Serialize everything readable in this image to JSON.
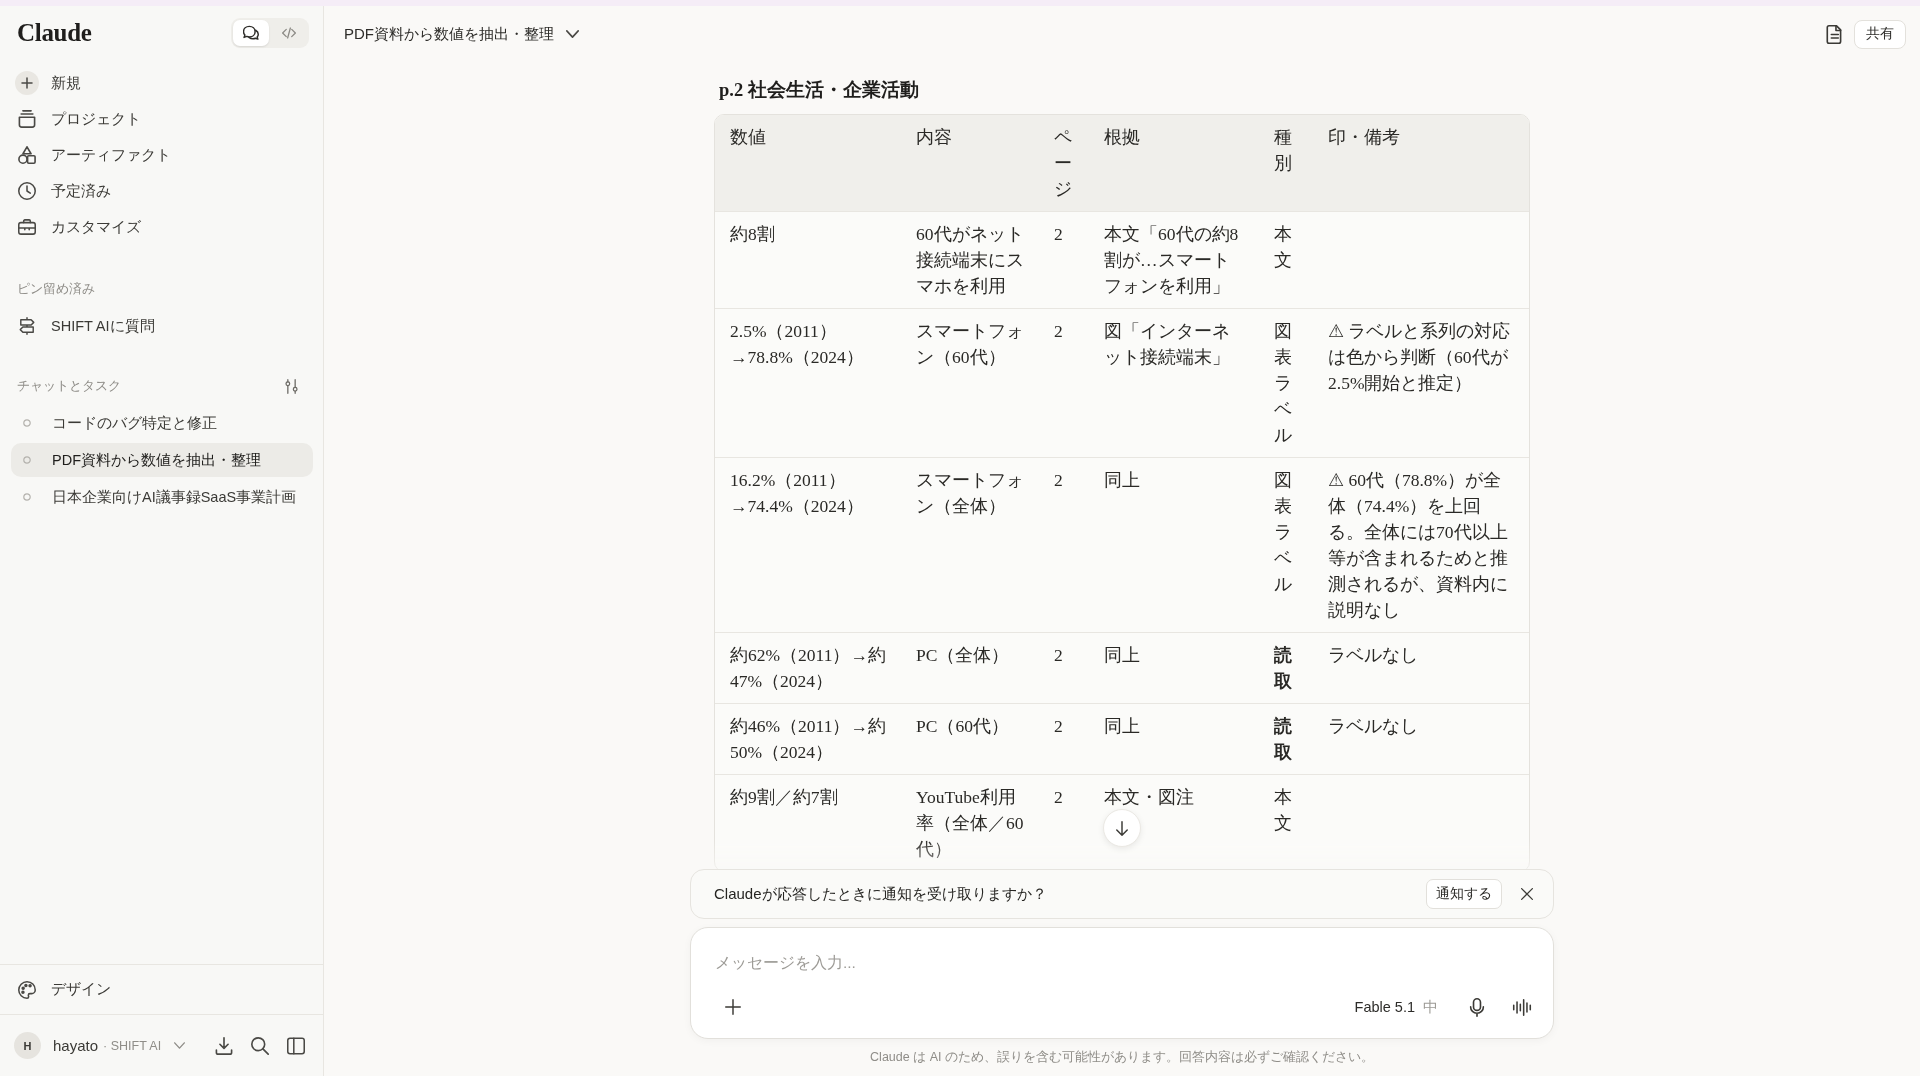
{
  "sidebar": {
    "logo": "Claude",
    "mode_tabs": [
      {
        "selected": true
      },
      {
        "selected": false
      }
    ],
    "nav": [
      {
        "label": "新規"
      },
      {
        "label": "プロジェクト"
      },
      {
        "label": "アーティファクト"
      },
      {
        "label": "予定済み"
      },
      {
        "label": "カスタマイズ"
      }
    ],
    "pinned": {
      "title": "ピン留め済み",
      "items": [
        {
          "label": "SHIFT AIに質問"
        }
      ]
    },
    "chats": {
      "title": "チャットとタスク",
      "items": [
        {
          "label": "コードのバグ特定と修正",
          "selected": false
        },
        {
          "label": "PDF資料から数値を抽出・整理",
          "selected": true
        },
        {
          "label": "日本企業向けAI議事録SaaS事業計画",
          "selected": false
        }
      ]
    },
    "design": {
      "label": "デザイン"
    },
    "user": {
      "initial": "H",
      "name": "hayato",
      "org": "· SHIFT AI"
    }
  },
  "header": {
    "title": "PDF資料から数値を抽出・整理",
    "share": "共有"
  },
  "content": {
    "heading": "p.2 社会生活・企業活動",
    "table": {
      "columns": [
        "数値",
        "内容",
        "ページ",
        "根拠",
        "種別",
        "印・備考"
      ],
      "rows": [
        {
          "cells": [
            "約8割",
            "60代がネット接続端末にスマホを利用",
            "2",
            "本文「60代の約8割が…スマートフォンを利用」",
            "本文"
          ],
          "category_bold": false
        },
        {
          "cells": [
            "2.5%（2011）→78.8%（2024）",
            "スマートフォン（60代）",
            "2",
            "図「インターネット接続端末」",
            "図表ラベル",
            "⚠ ラベルと系列の対応は色から判断（60代が2.5%開始と推定）"
          ],
          "category_bold": false
        },
        {
          "cells": [
            "16.2%（2011）→74.4%（2024）",
            "スマートフォン（全体）",
            "2",
            "同上",
            "図表ラベル",
            "⚠ 60代（78.8%）が全体（74.4%）を上回る。全体には70代以上等が含まれるためと推測されるが、資料内に説明なし"
          ],
          "category_bold": false
        },
        {
          "cells": [
            "約62%（2011）→約47%（2024）",
            "PC（全体）",
            "2",
            "同上",
            "読取",
            "ラベルなし"
          ],
          "category_bold": true
        },
        {
          "cells": [
            "約46%（2011）→約50%（2024）",
            "PC（60代）",
            "2",
            "同上",
            "読取",
            "ラベルなし"
          ],
          "category_bold": true
        },
        {
          "cells": [
            "約9割／約7割",
            "YouTube利用率（全体／60代）",
            "2",
            "本文・図注",
            "本文"
          ],
          "category_bold": false
        }
      ]
    }
  },
  "notification": {
    "text": "Claudeが応答したときに通知を受け取りますか？",
    "button": "通知する"
  },
  "composer": {
    "placeholder": "メッセージを入力...",
    "model": "Fable 5.1",
    "effort": "中"
  },
  "footer": {
    "disclaimer": "Claude は AI のため、誤りを含む可能性があります。回答内容は必ずご確認ください。"
  }
}
